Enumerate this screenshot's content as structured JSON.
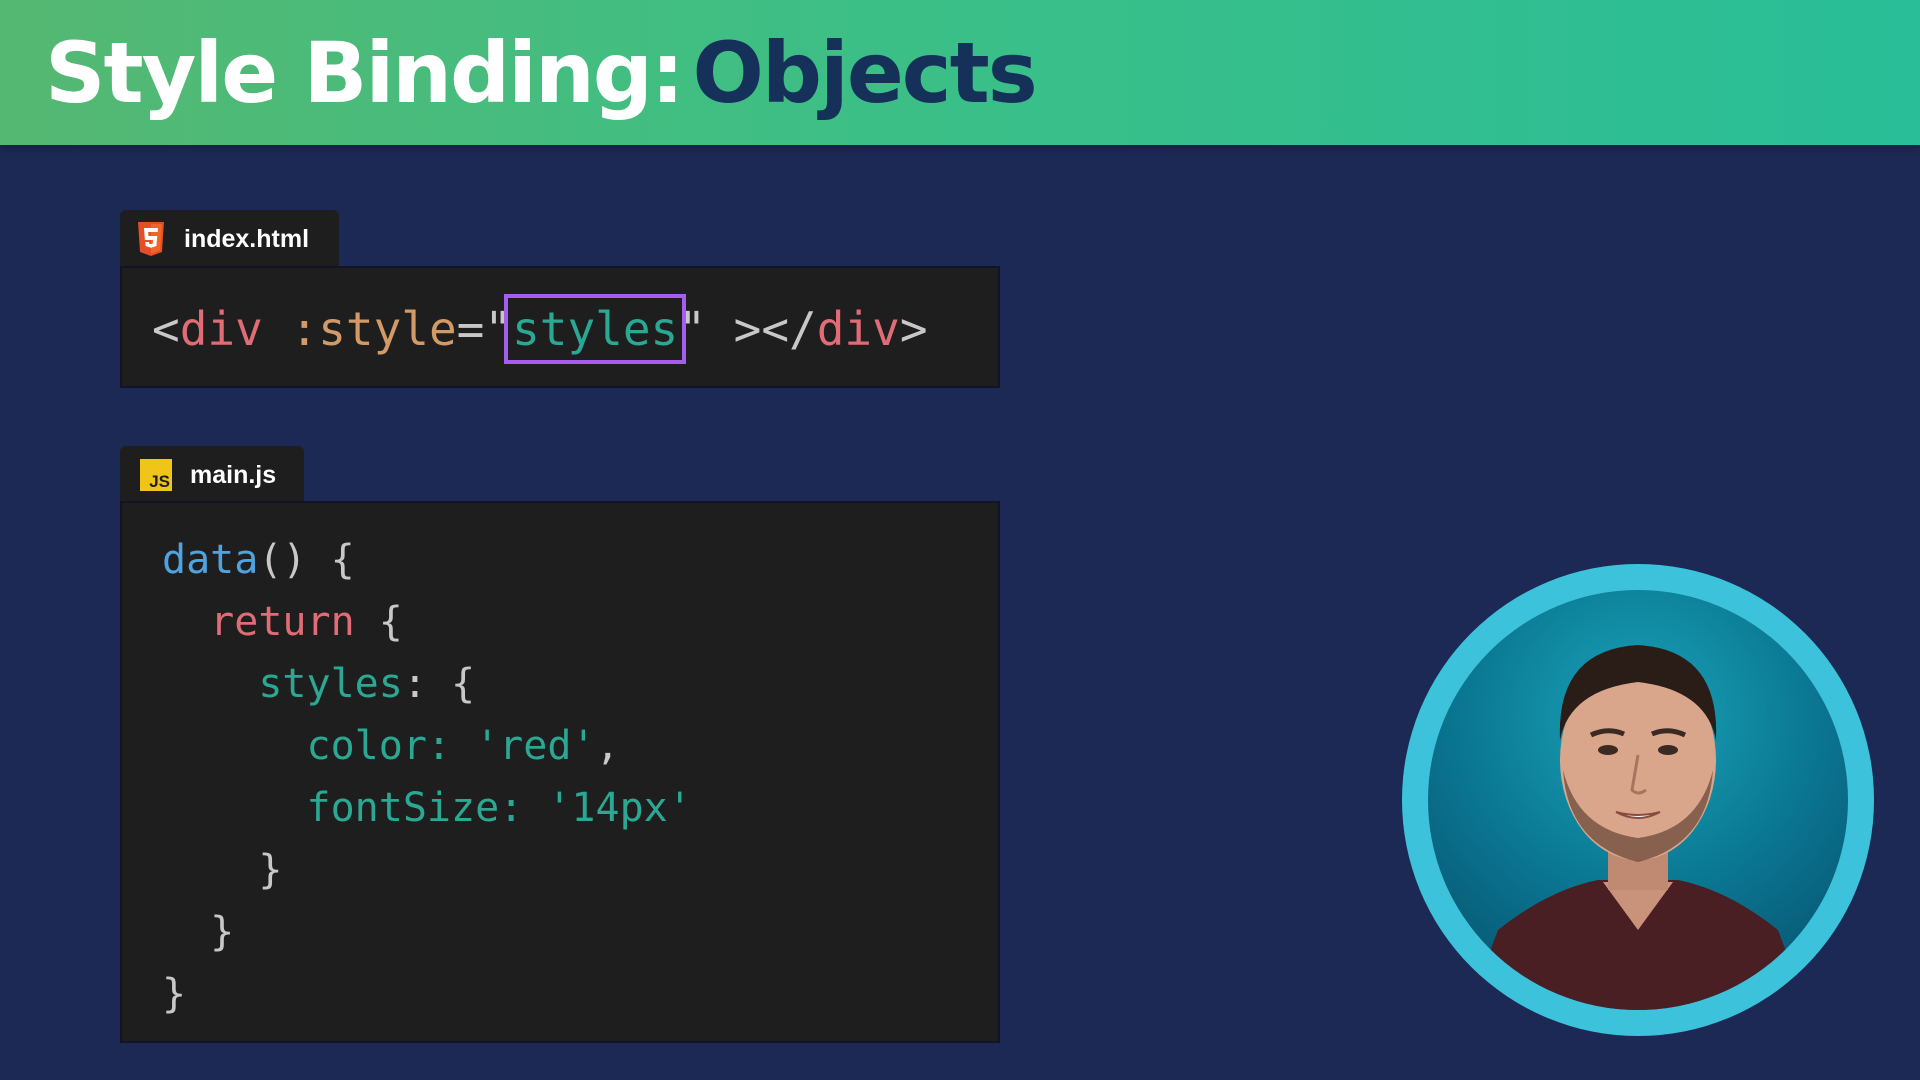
{
  "title": {
    "main": "Style Binding:",
    "accent": "Objects"
  },
  "html_file": {
    "name": "index.html",
    "icon": "html5-icon",
    "code": {
      "lt": "<",
      "tag_open": "div",
      "space": " ",
      "attr": ":style",
      "eq": "=",
      "quote_open": "\"",
      "value": "styles",
      "quote_close": "\"",
      "gt_lt_slash": " ></",
      "tag_close": "div",
      "gt": ">"
    }
  },
  "js_file": {
    "name": "main.js",
    "icon": "js-icon",
    "icon_text": "JS",
    "code": {
      "l1_fn": "data",
      "l1_rest": "() {",
      "l2_indent": "  ",
      "l2_kw": "return",
      "l2_rest": " {",
      "l3_indent": "    ",
      "l3_prop": "styles",
      "l3_rest": ": {",
      "l4_indent": "      ",
      "l4_prop": "color:",
      "l4_sp": " ",
      "l4_str": "'red'",
      "l4_rest": ",",
      "l5_indent": "      ",
      "l5_prop": "fontSize:",
      "l5_sp": " ",
      "l5_str": "'14px'",
      "l6": "    }",
      "l7": "  }",
      "l8": "}"
    }
  },
  "presenter": {
    "avatar": "presenter-webcam"
  },
  "colors": {
    "background": "#1d2955",
    "title_bar": "#3cbf86",
    "highlight": "#a55df0",
    "avatar_ring": "#3cc2da"
  }
}
